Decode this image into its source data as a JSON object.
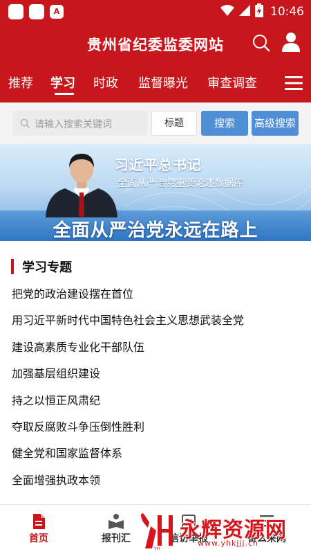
{
  "status_bar": {
    "time": "10:46",
    "app_icons": [
      "app-icon",
      "app-icon",
      "a-icon"
    ],
    "app_letter": "A",
    "indicators": [
      "wifi-icon",
      "signal-icon",
      "battery-charging-icon"
    ]
  },
  "header": {
    "title": "贵州省纪委监委网站",
    "brand_color": "#c8161d",
    "icons": [
      "search-icon",
      "user-icon"
    ]
  },
  "nav": {
    "tabs": [
      {
        "label": "推荐",
        "active": false
      },
      {
        "label": "学习",
        "active": true
      },
      {
        "label": "时政",
        "active": false
      },
      {
        "label": "监督曝光",
        "active": false
      },
      {
        "label": "审查调查",
        "active": false
      }
    ],
    "menu_icon": "hamburger-menu-icon"
  },
  "search": {
    "placeholder": "请输入搜索关键词",
    "value": "",
    "field_select": "标题",
    "search_label": "搜索",
    "advanced_label": "高级搜索",
    "button_color": "#4f8fd6"
  },
  "banner": {
    "title": "习近平总书记",
    "subtitle": "全面从严治党重要论述数据库",
    "slogan": "全面从严治党永远在路上"
  },
  "section": {
    "title": "学习专题",
    "items": [
      "把党的政治建设摆在首位",
      "用习近平新时代中国特色社会主义思想武装全党",
      "建设高素质专业化干部队伍",
      "加强基层组织建设",
      "持之以恒正风肃纪",
      "夺取反腐败斗争压倒性胜利",
      "健全党和国家监督体系",
      "全面增强执政本领"
    ]
  },
  "bottom_nav": {
    "items": [
      {
        "label": "首页",
        "icon": "document-icon",
        "active": true
      },
      {
        "label": "报刊汇",
        "icon": "reader-icon",
        "active": false
      },
      {
        "label": "信访举报",
        "icon": "report-icon",
        "active": false
      },
      {
        "label": "寄么来网",
        "icon": "list-icon",
        "active": false
      }
    ]
  },
  "watermark": {
    "logo_text": "YH",
    "text": "永辉资源网",
    "url": "www.yhkjjj.cn"
  }
}
